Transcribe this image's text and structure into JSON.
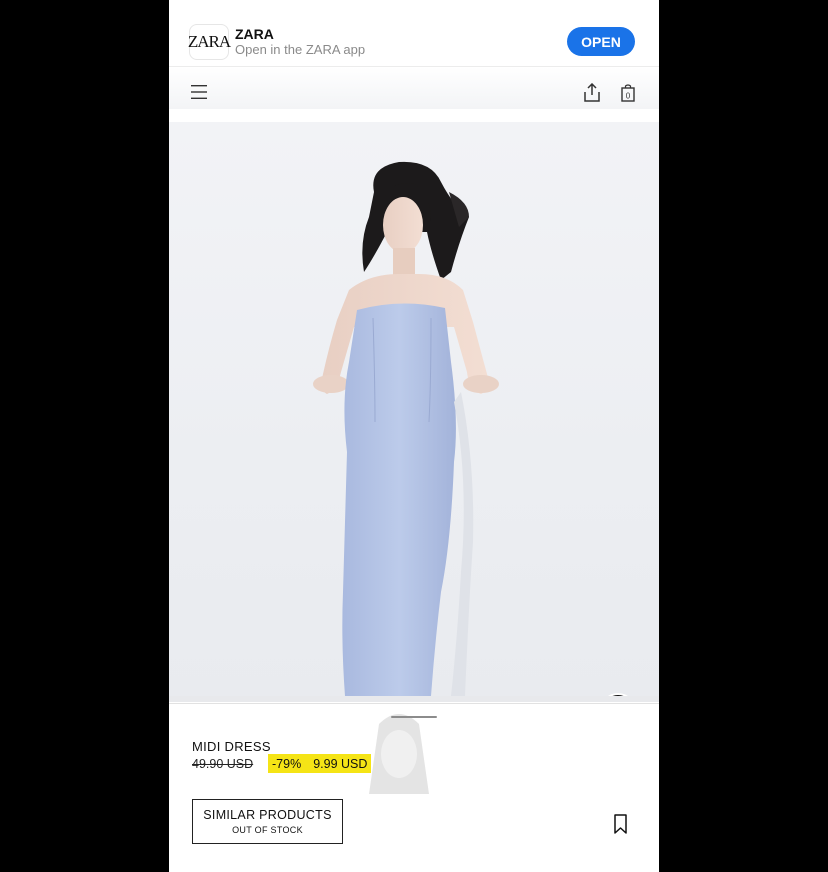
{
  "app_banner": {
    "logo_text": "ZARA",
    "app_name": "ZARA",
    "subtitle": "Open in the ZARA app",
    "open_label": "OPEN"
  },
  "nav": {
    "icons": [
      "menu-icon",
      "share-icon",
      "shopping-bag-icon"
    ],
    "bag_count": "0"
  },
  "product": {
    "name": "MIDI DRESS",
    "old_price": "49.90 USD",
    "discount": "-79%",
    "new_price": "9.99 USD",
    "similar_label": "SIMILAR PRODUCTS",
    "stock_status": "OUT OF STOCK"
  },
  "colors": {
    "accent": "#1a73e8",
    "price_highlight": "#f5e416",
    "dress": "#b4c4e6"
  }
}
